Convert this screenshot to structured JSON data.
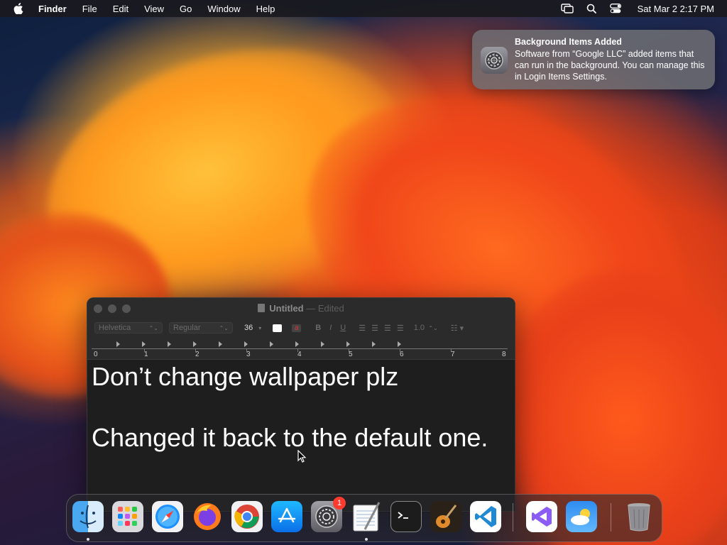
{
  "menubar": {
    "apple_icon": "apple-logo",
    "app_name": "Finder",
    "items": [
      "File",
      "Edit",
      "View",
      "Go",
      "Window",
      "Help"
    ],
    "status_icons": [
      "screen-mirroring-icon",
      "search-icon",
      "control-center-icon"
    ],
    "clock": "Sat Mar 2  2:17 PM"
  },
  "notification": {
    "icon": "system-settings-gear-icon",
    "title": "Background Items Added",
    "body": "Software from “Google LLC” added items that can run in the background. You can manage this in Login Items Settings."
  },
  "window": {
    "title": "Untitled",
    "separator": "—",
    "status": "Edited",
    "toolbar": {
      "font_family": "Helvetica",
      "font_style": "Regular",
      "font_size": "36",
      "bold": "B",
      "italic": "I",
      "underline": "U",
      "line_spacing": "1.0",
      "text_color_swatch": "#ffffff",
      "highlight_glyph": "a"
    },
    "ruler_numbers": [
      "0",
      "1",
      "2",
      "3",
      "4",
      "5",
      "6",
      "7",
      "8"
    ],
    "document": {
      "line1": "Don’t change wallpaper plz",
      "line2": "Changed it back to the default one."
    }
  },
  "dock": {
    "apps": [
      {
        "name": "Finder",
        "icon": "finder-icon",
        "running": true
      },
      {
        "name": "Launchpad",
        "icon": "launchpad-icon",
        "running": false
      },
      {
        "name": "Safari",
        "icon": "safari-icon",
        "running": false
      },
      {
        "name": "Firefox",
        "icon": "firefox-icon",
        "running": false
      },
      {
        "name": "Google Chrome",
        "icon": "chrome-icon",
        "running": false
      },
      {
        "name": "App Store",
        "icon": "app-store-icon",
        "running": false
      },
      {
        "name": "System Settings",
        "icon": "system-settings-icon",
        "running": false,
        "badge": "1"
      },
      {
        "name": "TextEdit",
        "icon": "textedit-icon",
        "running": true
      },
      {
        "name": "Terminal",
        "icon": "terminal-icon",
        "running": false
      },
      {
        "name": "GarageBand",
        "icon": "garageband-icon",
        "running": false
      },
      {
        "name": "Visual Studio Code",
        "icon": "vscode-icon",
        "running": false
      },
      {
        "name": "Visual Studio",
        "icon": "visual-studio-icon",
        "running": false
      },
      {
        "name": "Weather",
        "icon": "weather-icon",
        "running": false
      },
      {
        "name": "Trash",
        "icon": "trash-icon",
        "running": false
      }
    ]
  }
}
